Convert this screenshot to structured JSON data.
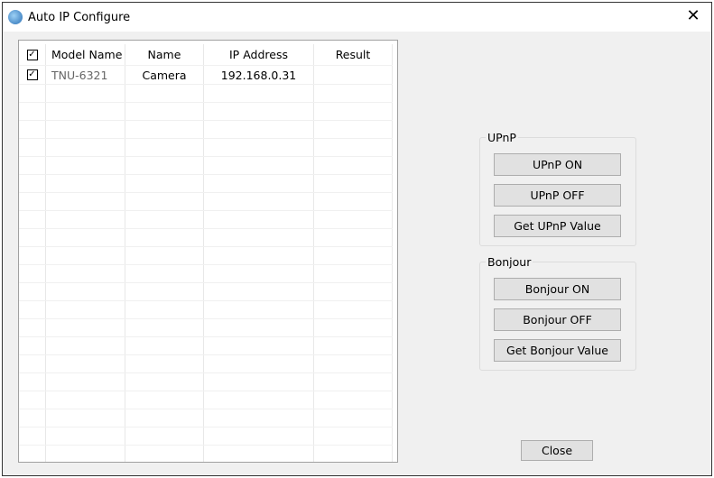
{
  "window": {
    "title": "Auto IP Configure",
    "close": "✕"
  },
  "list": {
    "headers": [
      "Model Name",
      "Name",
      "IP Address",
      "Result"
    ],
    "rows": [
      {
        "checked": true,
        "model": "TNU-6321",
        "name": "Camera",
        "ip": "192.168.0.31",
        "result": ""
      }
    ]
  },
  "upnp": {
    "label": "UPnP",
    "buttons": [
      "UPnP ON",
      "UPnP OFF",
      "Get UPnP Value"
    ]
  },
  "bonjour": {
    "label": "Bonjour",
    "buttons": [
      "Bonjour ON",
      "Bonjour OFF",
      "Get Bonjour Value"
    ]
  },
  "close_label": "Close"
}
